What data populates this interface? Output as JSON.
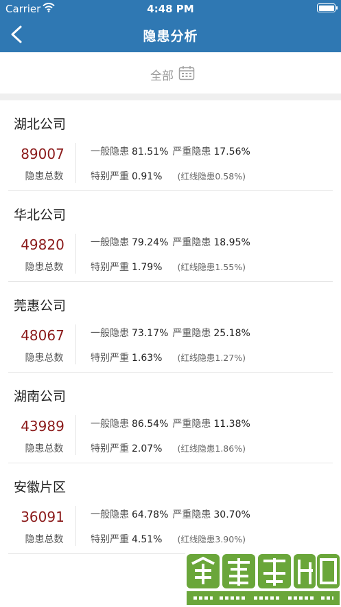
{
  "status_bar": {
    "carrier": "Carrier",
    "time": "4:48 PM"
  },
  "header": {
    "title": "隐患分析"
  },
  "filter": {
    "label": "全部"
  },
  "companies": [
    {
      "name": "湖北公司",
      "total": "89007",
      "total_label": "隐患总数",
      "general_label": "一般隐患",
      "general": "81.51%",
      "serious_label": "严重隐患",
      "serious": "17.56%",
      "special_label": "特别严重",
      "special": "0.91%",
      "redline": "(红线隐患0.58%)"
    },
    {
      "name": "华北公司",
      "total": "49820",
      "total_label": "隐患总数",
      "general_label": "一般隐患",
      "general": "79.24%",
      "serious_label": "严重隐患",
      "serious": "18.95%",
      "special_label": "特别严重",
      "special": "1.79%",
      "redline": "(红线隐患1.55%)"
    },
    {
      "name": "莞惠公司",
      "total": "48067",
      "total_label": "隐患总数",
      "general_label": "一般隐患",
      "general": "73.17%",
      "serious_label": "严重隐患",
      "serious": "25.18%",
      "special_label": "特别严重",
      "special": "1.63%",
      "redline": "(红线隐患1.27%)"
    },
    {
      "name": "湖南公司",
      "total": "43989",
      "total_label": "隐患总数",
      "general_label": "一般隐患",
      "general": "86.54%",
      "serious_label": "严重隐患",
      "serious": "11.38%",
      "special_label": "特别严重",
      "special": "2.07%",
      "redline": "(红线隐患1.86%)"
    },
    {
      "name": "安徽片区",
      "total": "36091",
      "total_label": "隐患总数",
      "general_label": "一般隐患",
      "general": "64.78%",
      "serious_label": "严重隐患",
      "serious": "30.70%",
      "special_label": "特别严重",
      "special": "4.51%",
      "redline": "(红线隐患3.90%)"
    }
  ],
  "colors": {
    "header": "#2f78b3",
    "total_number": "#8b1a1a",
    "watermark_green": "#6aa63a"
  }
}
